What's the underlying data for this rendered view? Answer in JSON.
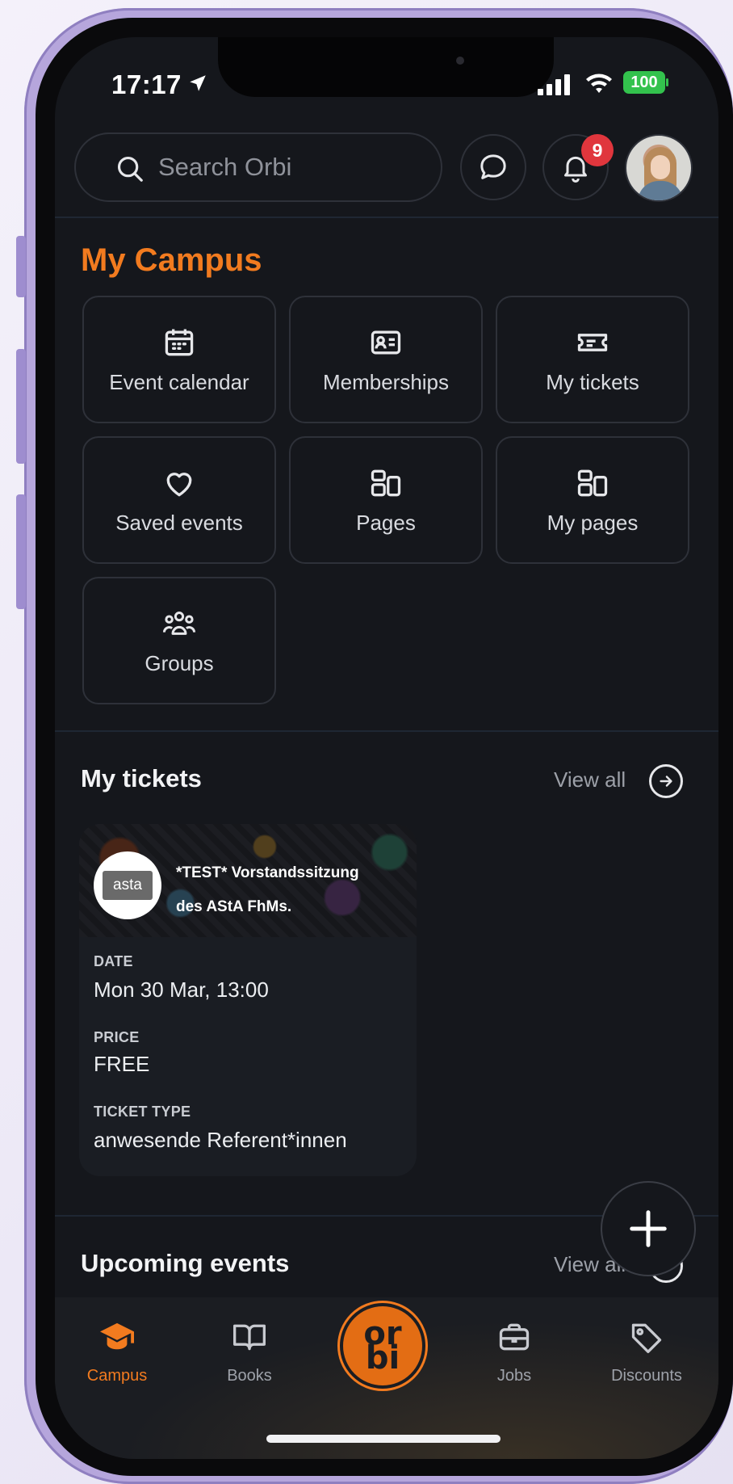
{
  "status": {
    "time": "17:17",
    "battery": "100",
    "icons": [
      "location-arrow-icon",
      "signal-icon",
      "wifi-icon",
      "battery-icon"
    ]
  },
  "topbar": {
    "search_placeholder": "Search Orbi",
    "notification_count": "9",
    "icons": [
      "search-icon",
      "chat-icon",
      "bell-icon"
    ]
  },
  "campus": {
    "title": "My Campus",
    "tiles": [
      {
        "label": "Event calendar",
        "icon": "calendar-icon"
      },
      {
        "label": "Memberships",
        "icon": "id-card-icon"
      },
      {
        "label": "My tickets",
        "icon": "ticket-icon"
      },
      {
        "label": "Saved events",
        "icon": "heart-icon"
      },
      {
        "label": "Pages",
        "icon": "pages-icon"
      },
      {
        "label": "My pages",
        "icon": "pages-icon"
      },
      {
        "label": "Groups",
        "icon": "groups-icon"
      }
    ]
  },
  "tickets": {
    "title": "My tickets",
    "view_all": "View all",
    "card": {
      "logo_text": "asta",
      "name_line1": "*TEST* Vorstandssitzung",
      "name_line2": "des AStA FhMs.",
      "date_label": "DATE",
      "date_value": "Mon 30 Mar, 13:00",
      "price_label": "PRICE",
      "price_value": "FREE",
      "type_label": "TICKET TYPE",
      "type_value": "anwesende Referent*innen"
    }
  },
  "upcoming": {
    "title": "Upcoming events",
    "view_all": "View all"
  },
  "nav": {
    "items": [
      {
        "label": "Campus",
        "icon": "graduation-cap-icon"
      },
      {
        "label": "Books",
        "icon": "book-icon"
      },
      {
        "label": "",
        "icon": "orbi-logo-icon"
      },
      {
        "label": "Jobs",
        "icon": "briefcase-icon"
      },
      {
        "label": "Discounts",
        "icon": "tag-icon"
      }
    ],
    "orbi_top": "or",
    "orbi_bottom": "bi"
  },
  "colors": {
    "accent": "#f27b1f",
    "background": "#15171c",
    "badge": "#e0363d",
    "battery": "#33c24d"
  }
}
